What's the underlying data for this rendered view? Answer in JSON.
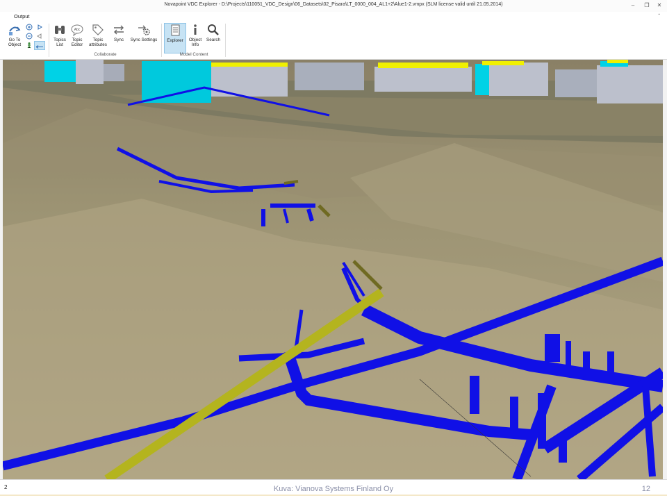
{
  "window": {
    "title": "Novapoint VDC Explorer - D:\\Projects\\110051_VDC_Design\\06_Datasets\\02_Pisara\\LT_0000_004_AL1+2\\Alue1-2.vmpx (SLM license valid until 21.05.2014)"
  },
  "menu": {
    "output_tab": "Output"
  },
  "ribbon": {
    "goto_object": {
      "line1": "Go To",
      "line2": "Object",
      "icon": "goto-object-icon"
    },
    "collaborate": {
      "label": "Collaborate",
      "topics_list": {
        "line1": "Topics",
        "line2": "List",
        "icon": "binoculars-icon"
      },
      "topic_editor": {
        "line1": "Topic",
        "line2": "Editor",
        "icon": "abc-bubble-icon"
      },
      "topic_attributes": {
        "line1": "Topic",
        "line2": "attributes",
        "icon": "tag-icon"
      },
      "sync": {
        "line1": "Sync",
        "icon": "sync-arrows-icon"
      },
      "sync_settings": {
        "line1": "Sync Settings",
        "icon": "settings-icon"
      }
    },
    "model_content": {
      "label": "Model Content",
      "explorer": {
        "line1": "Explorer",
        "icon": "explorer-list-icon",
        "active": true
      },
      "object_info": {
        "line1": "Object",
        "line2": "Info",
        "icon": "info-icon"
      },
      "search": {
        "line1": "Search",
        "icon": "magnifier-icon"
      }
    }
  },
  "footer": {
    "left_number": "2",
    "caption": "Kuva: Vianova Systems Finland Oy",
    "page_number": "12"
  },
  "colors": {
    "pipe_blue": "#1010e6",
    "pipe_yellow": "#b4b41e",
    "terrain": "#a89f7c",
    "building_cyan": "#00d2e6",
    "building_grey": "#bcc0cc",
    "roof_yellow": "#f0f000",
    "active_button": "#c7e3f4"
  }
}
